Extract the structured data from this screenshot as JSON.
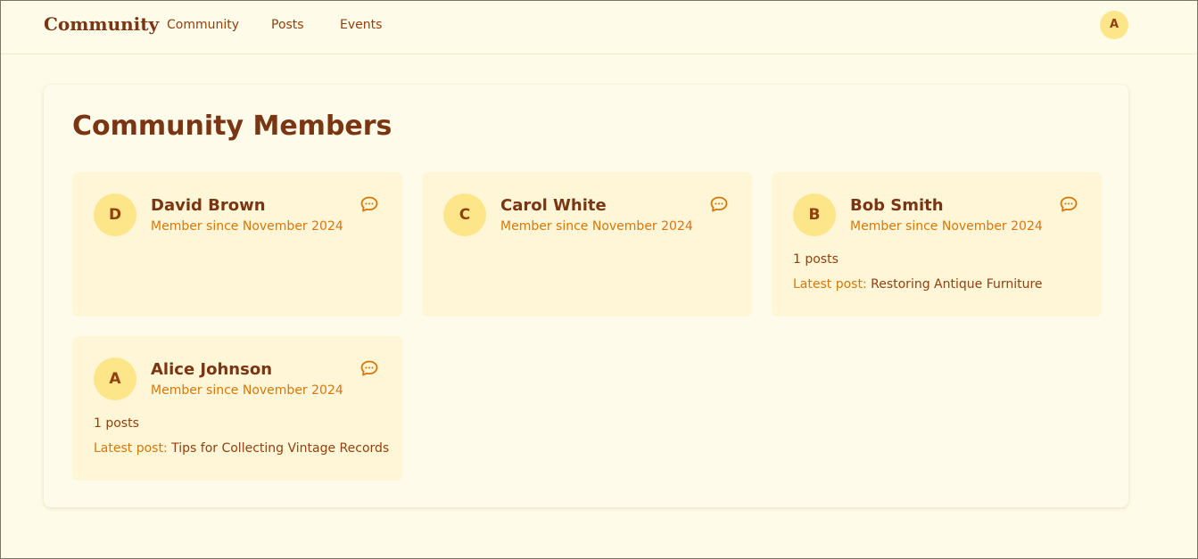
{
  "header": {
    "brand": "Community",
    "nav": [
      {
        "label": "Community"
      },
      {
        "label": "Posts"
      },
      {
        "label": "Events"
      }
    ],
    "user_initial": "A"
  },
  "main": {
    "title": "Community Members",
    "members": [
      {
        "initial": "D",
        "name": "David Brown",
        "since": "Member since November 2024"
      },
      {
        "initial": "C",
        "name": "Carol White",
        "since": "Member since November 2024"
      },
      {
        "initial": "B",
        "name": "Bob Smith",
        "since": "Member since November 2024",
        "posts": "1 posts",
        "latest_label": "Latest post:",
        "latest_title": "Restoring Antique Furniture"
      },
      {
        "initial": "A",
        "name": "Alice Johnson",
        "since": "Member since November 2024",
        "posts": "1 posts",
        "latest_label": "Latest post:",
        "latest_title": "Tips for Collecting Vintage Records"
      }
    ]
  },
  "icons": {
    "message": "message-circle-icon"
  },
  "colors": {
    "background": "#fefbe8",
    "card": "#fff6d7",
    "accent": "#d97706",
    "text_dark": "#7a3612",
    "text_mid": "#92400e",
    "avatar": "#fde68a"
  }
}
